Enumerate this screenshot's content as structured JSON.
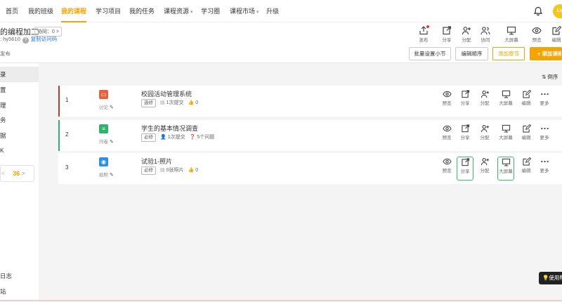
{
  "nav": {
    "items": [
      {
        "label": "首页"
      },
      {
        "label": "我的班级"
      },
      {
        "label": "我的课程",
        "active": true
      },
      {
        "label": "学习项目"
      },
      {
        "label": "我的任务"
      },
      {
        "label": "课程资源",
        "dropdown": true
      },
      {
        "label": "学习圈"
      },
      {
        "label": "课程市场",
        "dropdown": true
      },
      {
        "label": "升级"
      }
    ],
    "avatar_text": "LV"
  },
  "header": {
    "course_title": "的编程加工",
    "collab_label": "协同：0 >",
    "invite_prefix": ": hy5610",
    "invite_q": "?",
    "invite_link": "复制访问码",
    "publish_text": "发布",
    "tools": [
      {
        "label": "发布",
        "icon": "publish-icon"
      },
      {
        "label": "分享",
        "icon": "share-icon"
      },
      {
        "label": "分配",
        "icon": "assign-icon"
      },
      {
        "label": "协同",
        "icon": "collab-icon"
      },
      {
        "label": "大屏幕",
        "icon": "screen-icon"
      },
      {
        "label": "预览",
        "icon": "eye-icon"
      },
      {
        "label": "编辑",
        "icon": "edit-icon"
      }
    ],
    "buttons": {
      "batch": "批量设置小节",
      "reorder": "编辑顺序",
      "add_chapter": "添加章节",
      "add_activity": "+ 添加课程"
    }
  },
  "sidebar": {
    "items": [
      {
        "label": "录",
        "active": true
      },
      {
        "label": "置"
      },
      {
        "label": "理"
      },
      {
        "label": "务"
      },
      {
        "label": "据"
      },
      {
        "label": "K"
      }
    ],
    "pager": {
      "prev": "<",
      "num": "36",
      "next": ">"
    },
    "bottom_items": [
      {
        "label": "日志"
      },
      {
        "label": "站"
      }
    ]
  },
  "content": {
    "sort_label": "倒序",
    "activities": [
      {
        "index": "1",
        "type_label": "讨论",
        "type_color": "#e8603c",
        "name": "校园活动管理系统",
        "tag": "选修",
        "stats": [
          {
            "icon": "doc-icon",
            "text": "1次提交"
          },
          {
            "icon": "like-icon",
            "text": "0"
          }
        ],
        "accent": "#c0392b"
      },
      {
        "index": "2",
        "type_label": "问卷",
        "type_color": "#2fb36b",
        "name": "学生的基本情况调查",
        "tag": "必修",
        "stats": [
          {
            "icon": "user-icon",
            "text": "1次提交"
          },
          {
            "icon": "question-icon",
            "text": "5个问题"
          }
        ],
        "accent": "#2fb36b"
      },
      {
        "index": "3",
        "type_label": "拍照",
        "type_color": "#2f8fe8",
        "name": "试验1-照片",
        "tag": "必修",
        "stats": [
          {
            "icon": "photo-icon",
            "text": "0张照片"
          },
          {
            "icon": "like-icon",
            "text": "0"
          }
        ],
        "accent": ""
      }
    ],
    "row_actions": [
      "预览",
      "分享",
      "分配",
      "大屏幕",
      "编辑",
      "更多"
    ]
  },
  "help_label": "使用帮助",
  "colors": {
    "accent": "#f5a300",
    "highlight": "#3dbb6b",
    "link": "#2f7bdc"
  }
}
